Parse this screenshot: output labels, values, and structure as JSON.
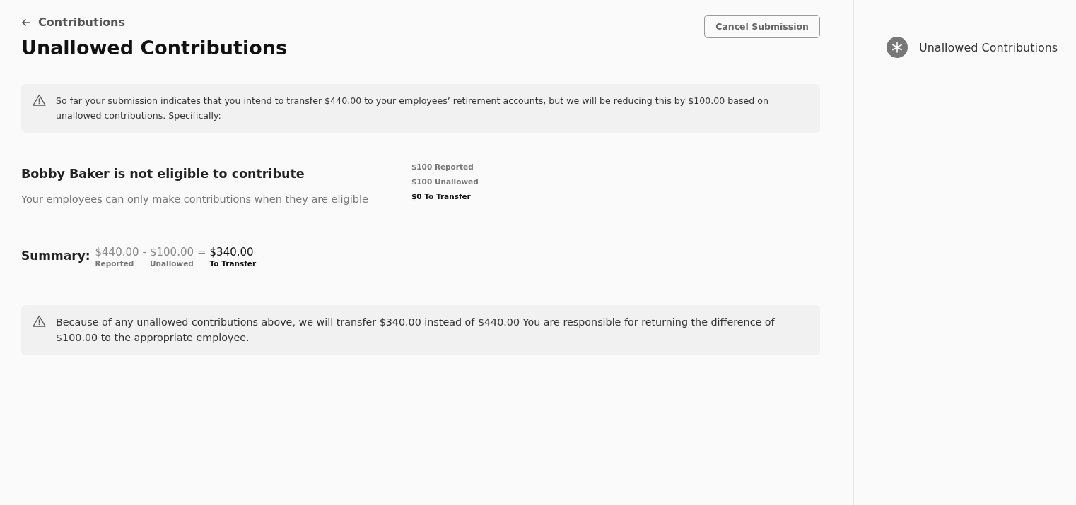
{
  "header": {
    "back_label": "Contributions",
    "title": "Unallowed Contributions",
    "cancel_button": "Cancel Submission"
  },
  "notice": "So far your submission indicates that you intend to transfer $440.00 to your employees’ retirement accounts, but we will be reducing this by $100.00 based on unallowed contributions. Specifically:",
  "issues": [
    {
      "title": "Bobby Baker is not eligible to contribute",
      "description": "Your employees can only make contributions when they are eligible",
      "breakdown": [
        {
          "text": "$100 Reported",
          "kind": "normal"
        },
        {
          "text": "$100 Unallowed",
          "kind": "normal"
        },
        {
          "text": "$0 To Transfer",
          "kind": "total"
        }
      ]
    }
  ],
  "summary": {
    "label": "Summary:",
    "items": [
      {
        "kind": "term",
        "value": "$440.00",
        "caption": "Reported"
      },
      {
        "kind": "operator",
        "value": "-"
      },
      {
        "kind": "term",
        "value": "$100.00",
        "caption": "Unallowed"
      },
      {
        "kind": "operator",
        "value": "="
      },
      {
        "kind": "result",
        "value": "$340.00",
        "caption": "To Transfer"
      }
    ]
  },
  "footer_notice": "Because of any unallowed contributions above, we will transfer $340.00 instead of $440.00 You are responsible for returning the difference of $100.00 to the appropriate employee.",
  "sidebar": {
    "steps": [
      {
        "label": "Unallowed Contributions",
        "selected": true
      }
    ]
  }
}
